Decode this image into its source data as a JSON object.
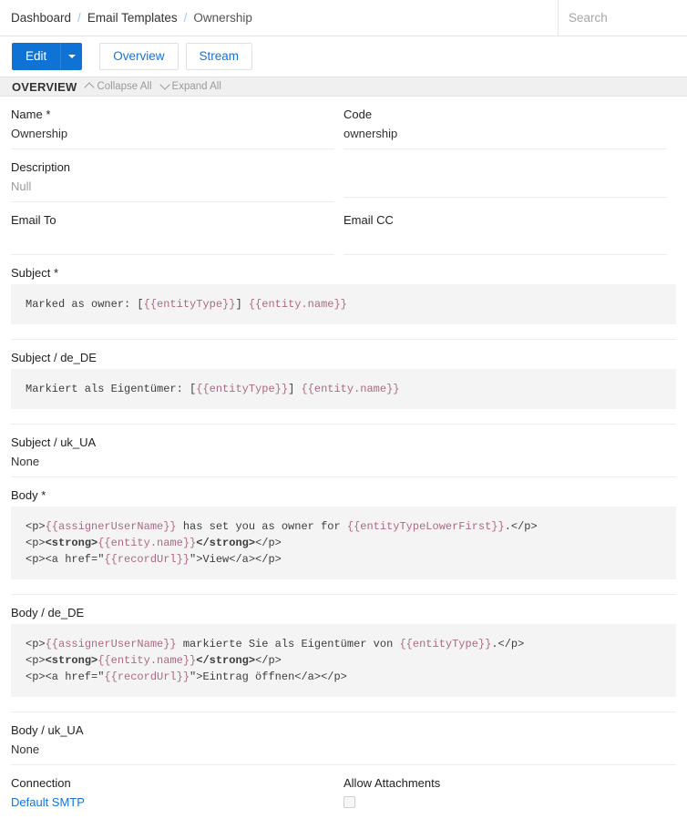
{
  "navbar": {
    "breadcrumb": [
      {
        "label": "Dashboard",
        "current": false
      },
      {
        "label": "Email Templates",
        "current": false
      },
      {
        "label": "Ownership",
        "current": true
      }
    ],
    "separator": "/",
    "search_placeholder": "Search",
    "search_value": ""
  },
  "toolbar": {
    "edit_label": "Edit",
    "dropdown_icon": "caret-down-icon",
    "overview_label": "Overview",
    "stream_label": "Stream"
  },
  "panel": {
    "title": "OVERVIEW",
    "collapse_all": "Collapse All",
    "expand_all": "Expand All",
    "collapse_icon": "chevron-up-icon",
    "expand_icon": "chevron-down-icon"
  },
  "fields": {
    "name": {
      "label": "Name",
      "required": "*",
      "value": "Ownership"
    },
    "code": {
      "label": "Code",
      "value": "ownership"
    },
    "description": {
      "label": "Description",
      "value": "Null"
    },
    "email_to": {
      "label": "Email To",
      "value": ""
    },
    "email_cc": {
      "label": "Email CC",
      "value": ""
    },
    "subject": {
      "label": "Subject",
      "required": "*",
      "code": "Marked as owner: [{{entityType}}] {{entity.name}}"
    },
    "subject_de": {
      "label": "Subject / de_DE",
      "code": "Markiert als Eigentümer: [{{entityType}}] {{entity.name}}"
    },
    "subject_uk": {
      "label": "Subject / uk_UA",
      "value": "None"
    },
    "body": {
      "label": "Body",
      "required": "*",
      "lines": [
        "<p>{{assignerUserName}} has set you as owner for {{entityTypeLowerFirst}}.</p>",
        "<p><strong>{{entity.name}}</strong></p>",
        "<p><a href=\"{{recordUrl}}\">View</a></p>"
      ]
    },
    "body_de": {
      "label": "Body / de_DE",
      "lines": [
        "<p>{{assignerUserName}} markierte Sie als Eigentümer von {{entityType}}.</p>",
        "<p><strong>{{entity.name}}</strong></p>",
        "<p><a href=\"{{recordUrl}}\">Eintrag öffnen</a></p>"
      ]
    },
    "body_uk": {
      "label": "Body / uk_UA",
      "value": "None"
    },
    "connection": {
      "label": "Connection",
      "value": "Default SMTP"
    },
    "allow_attachments": {
      "label": "Allow Attachments",
      "checked": false
    }
  },
  "colors": {
    "primary": "#0f72d5",
    "link": "#1273de",
    "template_token": "#ab6b7d",
    "code_bg": "#f4f4f4",
    "panel_bg": "#f0f0f0"
  }
}
